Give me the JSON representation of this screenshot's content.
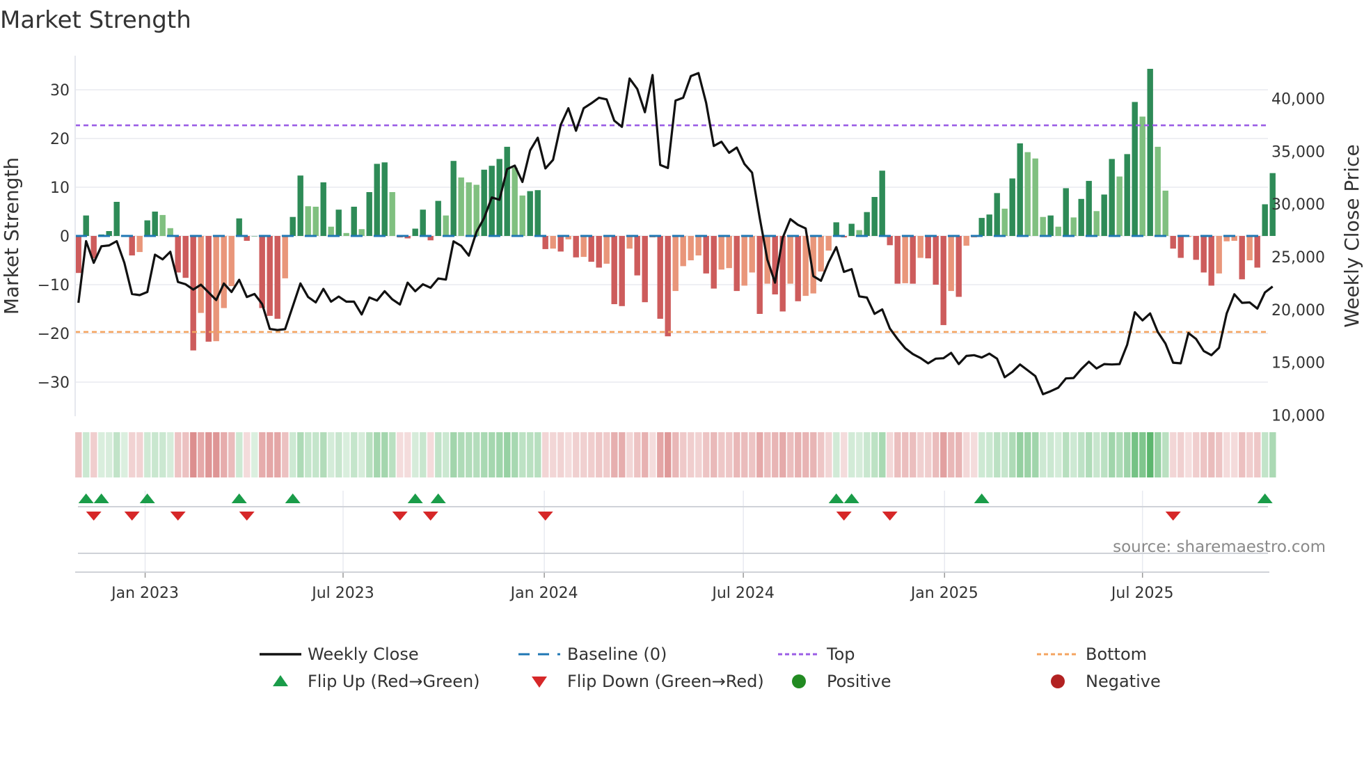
{
  "chart_data": {
    "type": "bar",
    "title": "Market Strength",
    "ylabel": "Market Strength",
    "y2label": "Weekly Close Price",
    "ylim": [
      -37,
      37
    ],
    "y2lim": [
      9900,
      44050
    ],
    "yticks": [
      30,
      20,
      10,
      0,
      -10,
      -20,
      -30
    ],
    "ytick_labels": [
      "30",
      "20",
      "10",
      "0",
      "−10",
      "−20",
      "−30"
    ],
    "y2ticks": [
      40000,
      35000,
      30000,
      25000,
      20000,
      15000,
      10000
    ],
    "y2tick_labels": [
      "40,000",
      "35,000",
      "30,000",
      "25,000",
      "20,000",
      "15,000",
      "10,000"
    ],
    "start_date": "2022-11-01",
    "frequency": "weekly",
    "xticks": [
      {
        "date": "2023-01-01",
        "label": "Jan 2023"
      },
      {
        "date": "2023-07-01",
        "label": "Jul 2023"
      },
      {
        "date": "2024-01-01",
        "label": "Jan 2024"
      },
      {
        "date": "2024-07-01",
        "label": "Jul 2024"
      },
      {
        "date": "2025-01-01",
        "label": "Jan 2025"
      },
      {
        "date": "2025-07-01",
        "label": "Jul 2025"
      }
    ],
    "top_level": 22.7,
    "bottom_level": -19.7,
    "baseline": 0,
    "series": [
      {
        "name": "Market Strength",
        "kind": "bar",
        "values": [
          -7.6,
          4.2,
          -4.6,
          0.3,
          1,
          7,
          0,
          -4,
          -3.3,
          3.2,
          5,
          4.3,
          1.6,
          -7.5,
          -8.6,
          -23.5,
          -15.8,
          -21.7,
          -21.6,
          -14.8,
          -10.3,
          3.6,
          -1,
          0,
          -14.8,
          -16.4,
          -17,
          -8.7,
          3.9,
          12.4,
          6.1,
          6,
          11,
          1.9,
          5.4,
          0.6,
          6,
          1.4,
          9,
          14.8,
          15.1,
          9,
          -0.3,
          -0.5,
          1.5,
          5.4,
          -0.9,
          7.2,
          4.2,
          15.4,
          12,
          11,
          10.5,
          13.6,
          14.4,
          15.8,
          18.3,
          14,
          8.3,
          9.2,
          9.4,
          -2.7,
          -2.6,
          -3.2,
          -0.7,
          -4.4,
          -4.3,
          -5.3,
          -6.5,
          -5.7,
          -14,
          -14.4,
          -2.6,
          -8.1,
          -13.6,
          -0.3,
          -17,
          -20.6,
          -11.3,
          -6.2,
          -5,
          -4,
          -7.7,
          -10.8,
          -6.9,
          -6.6,
          -11.3,
          -10.2,
          -7.5,
          -16,
          -9.8,
          -12,
          -15.5,
          -9.8,
          -13.4,
          -12.3,
          -11.8,
          -7.3,
          -3,
          2.8,
          -0.3,
          2.5,
          1.2,
          4.9,
          8,
          13.4,
          -1.9,
          -9.8,
          -9.7,
          -9.8,
          -4.5,
          -4.6,
          -10,
          -18.3,
          -11.3,
          -12.5,
          -2,
          -0.3,
          3.7,
          4.4,
          8.8,
          5.6,
          11.8,
          19,
          17.2,
          15.9,
          3.9,
          4.2,
          1.9,
          9.8,
          3.8,
          7.6,
          11.3,
          5.1,
          8.5,
          15.8,
          12.2,
          16.8,
          27.5,
          24.5,
          34.3,
          18.3,
          9.3,
          -2.6,
          -4.5,
          -0.2,
          -4.9,
          -7.5,
          -10.2,
          -7.7,
          -1.1,
          -1,
          -8.9,
          -5,
          -6.5,
          6.5,
          12.9
        ]
      },
      {
        "name": "Weekly Close",
        "kind": "line",
        "axis": "right",
        "values": [
          20640,
          26480,
          24430,
          26000,
          26080,
          26480,
          24430,
          21480,
          21370,
          21670,
          25200,
          24760,
          25480,
          22620,
          22400,
          21900,
          22360,
          21630,
          20900,
          22470,
          21670,
          22820,
          21190,
          21480,
          20530,
          18170,
          18060,
          18150,
          20310,
          22470,
          21190,
          20680,
          21960,
          20750,
          21230,
          20750,
          20750,
          19540,
          21150,
          20860,
          21740,
          20970,
          20480,
          22550,
          21740,
          22400,
          22070,
          22950,
          22840,
          26470,
          26030,
          25110,
          27360,
          28680,
          30620,
          30400,
          33310,
          33640,
          32090,
          35070,
          36280,
          33370,
          34180,
          37490,
          39070,
          36940,
          39070,
          39540,
          40070,
          39910,
          37890,
          37310,
          41890,
          40900,
          38700,
          42220,
          33700,
          33410,
          39800,
          40070,
          42110,
          42400,
          39580,
          35500,
          35900,
          34850,
          35350,
          33790,
          32970,
          28680,
          24720,
          22550,
          26800,
          28570,
          28020,
          27690,
          23170,
          22730,
          24490,
          25920,
          23570,
          23830,
          21250,
          21140,
          19600,
          20020,
          18210,
          17220,
          16340,
          15790,
          15410,
          14910,
          15350,
          15390,
          15900,
          14840,
          15610,
          15680,
          15460,
          15830,
          15350,
          13590,
          14100,
          14800,
          14250,
          13700,
          11980,
          12270,
          12600,
          13480,
          13520,
          14360,
          15060,
          14420,
          14840,
          14800,
          14840,
          16670,
          19750,
          18980,
          19640,
          17880,
          16780,
          14970,
          14910,
          17780,
          17220,
          16080,
          15680,
          16380,
          19640,
          21450,
          20640,
          20680,
          20090,
          21630,
          22180
        ]
      }
    ],
    "flip_up_weeks": [
      1,
      3,
      9,
      21,
      28,
      44,
      47,
      99,
      101,
      118,
      155
    ],
    "flip_down_weeks": [
      2,
      7,
      13,
      22,
      42,
      46,
      61,
      100,
      106,
      143
    ],
    "legend": {
      "placement": "bottom",
      "items": [
        {
          "label": "Weekly Close",
          "kind": "line"
        },
        {
          "label": "Baseline (0)",
          "kind": "dash"
        },
        {
          "label": "Top",
          "kind": "dot-purple"
        },
        {
          "label": "Bottom",
          "kind": "dot-orange"
        },
        {
          "label": "Flip Up (Red→Green)",
          "kind": "tri-up"
        },
        {
          "label": "Flip Down (Green→Red)",
          "kind": "tri-down"
        },
        {
          "label": "Positive",
          "kind": "dot-green"
        },
        {
          "label": "Negative",
          "kind": "dot-red"
        }
      ]
    },
    "source": "source: sharemaestro.com",
    "colors": {
      "pos_rising": "#2e8b57",
      "pos_falling": "#80c080",
      "neg_falling": "#cd5c5c",
      "neg_rising": "#e9967a",
      "line": "#111111",
      "baseline": "#1f77b4",
      "top": "#9b5de5",
      "bottom": "#f4a460",
      "flip_up": "#1a9c49",
      "flip_down": "#d62728",
      "positive": "#228b22",
      "negative": "#b22222"
    }
  }
}
